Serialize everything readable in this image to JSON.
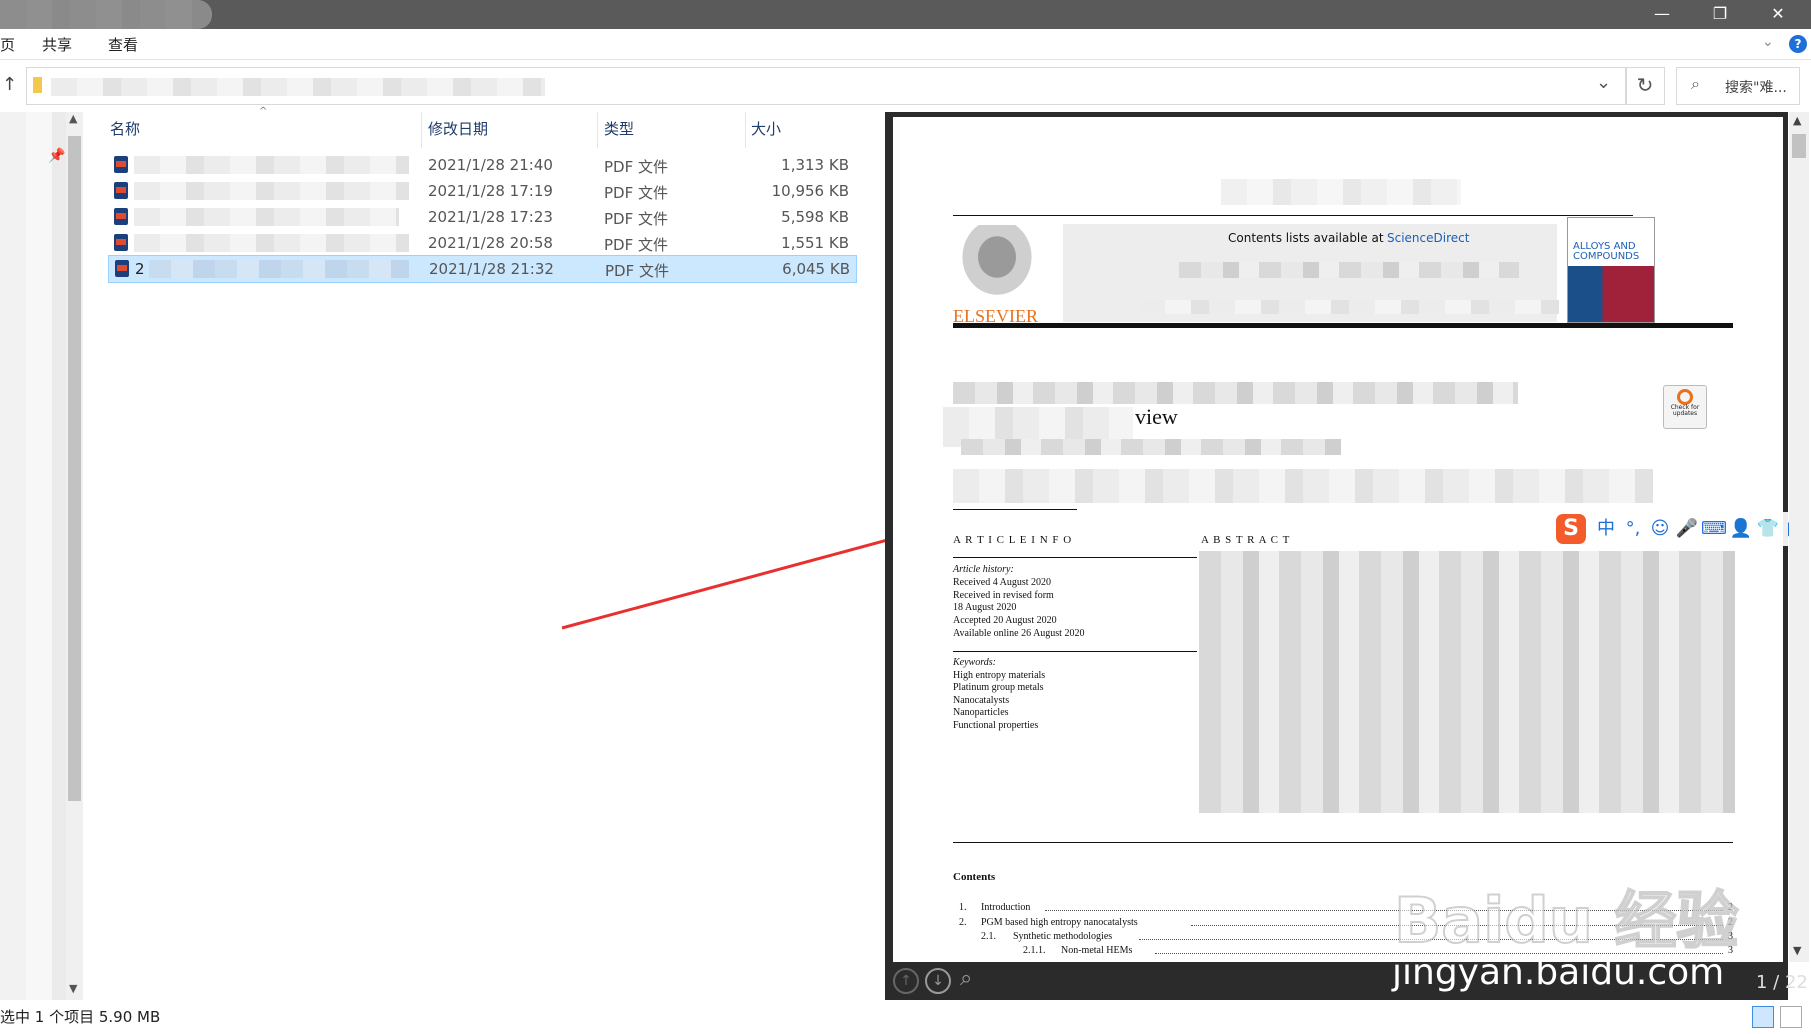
{
  "window": {
    "minimize": "—",
    "restore": "❐",
    "close": "✕"
  },
  "ribbon": {
    "tab_partial": "页",
    "tab_share": "共享",
    "tab_view": "查看",
    "help": "?"
  },
  "address": {
    "up": "↑",
    "refresh": "↻",
    "dropdown": "⌄"
  },
  "search": {
    "placeholder": "搜索\"难..."
  },
  "columns": {
    "name": "名称",
    "modified": "修改日期",
    "type": "类型",
    "size": "大小"
  },
  "files": [
    {
      "modified": "2021/1/28 21:40",
      "type": "PDF 文件",
      "size": "1,313 KB"
    },
    {
      "modified": "2021/1/28 17:19",
      "type": "PDF 文件",
      "size": "10,956 KB"
    },
    {
      "modified": "2021/1/28 17:23",
      "type": "PDF 文件",
      "size": "5,598 KB"
    },
    {
      "modified": "2021/1/28 20:58",
      "type": "PDF 文件",
      "size": "1,551 KB"
    },
    {
      "modified": "2021/1/28 21:32",
      "type": "PDF 文件",
      "size": "6,045 KB",
      "name_prefix": "2"
    }
  ],
  "pdf": {
    "contents_available": "Contents lists available at",
    "sciencedirect": "ScienceDirect",
    "publisher": "ELSEVIER",
    "journal": "ALLOYS AND COMPOUNDS",
    "check_updates": "Check for updates",
    "title_fragment": "view",
    "article_info": "A R T I C L E   I N F O",
    "abstract": "A B S T R A C T",
    "history_label": "Article history:",
    "history": [
      "Received 4 August 2020",
      "Received in revised form",
      "18 August 2020",
      "Accepted 20 August 2020",
      "Available online 26 August 2020"
    ],
    "keywords_label": "Keywords:",
    "keywords": [
      "High entropy materials",
      "Platinum group metals",
      "Nanocatalysts",
      "Nanoparticles",
      "Functional properties"
    ],
    "contents_label": "Contents",
    "toc": [
      {
        "num": "1.",
        "title": "Introduction",
        "page": "2"
      },
      {
        "num": "2.",
        "title": "PGM based high entropy nanocatalysts",
        "page": "2"
      },
      {
        "num": "2.1.",
        "title": "Synthetic methodologies",
        "page": "3"
      },
      {
        "num": "2.1.1.",
        "title": "Non-metal HEMs",
        "page": "3"
      }
    ],
    "page_indicator": "1 / 22"
  },
  "watermark": {
    "brand": "Baidu 经验",
    "url": "jingyan.baidu.com"
  },
  "status": {
    "selection": "选中 1 个项目  5.90 MB"
  },
  "sogou": {
    "zh": "中",
    "punct": "°,"
  },
  "colors": {
    "selection_bg": "#cce8ff",
    "arrow": "#e8312f",
    "link": "#1a5fb4",
    "elsevier_orange": "#e9711c"
  }
}
